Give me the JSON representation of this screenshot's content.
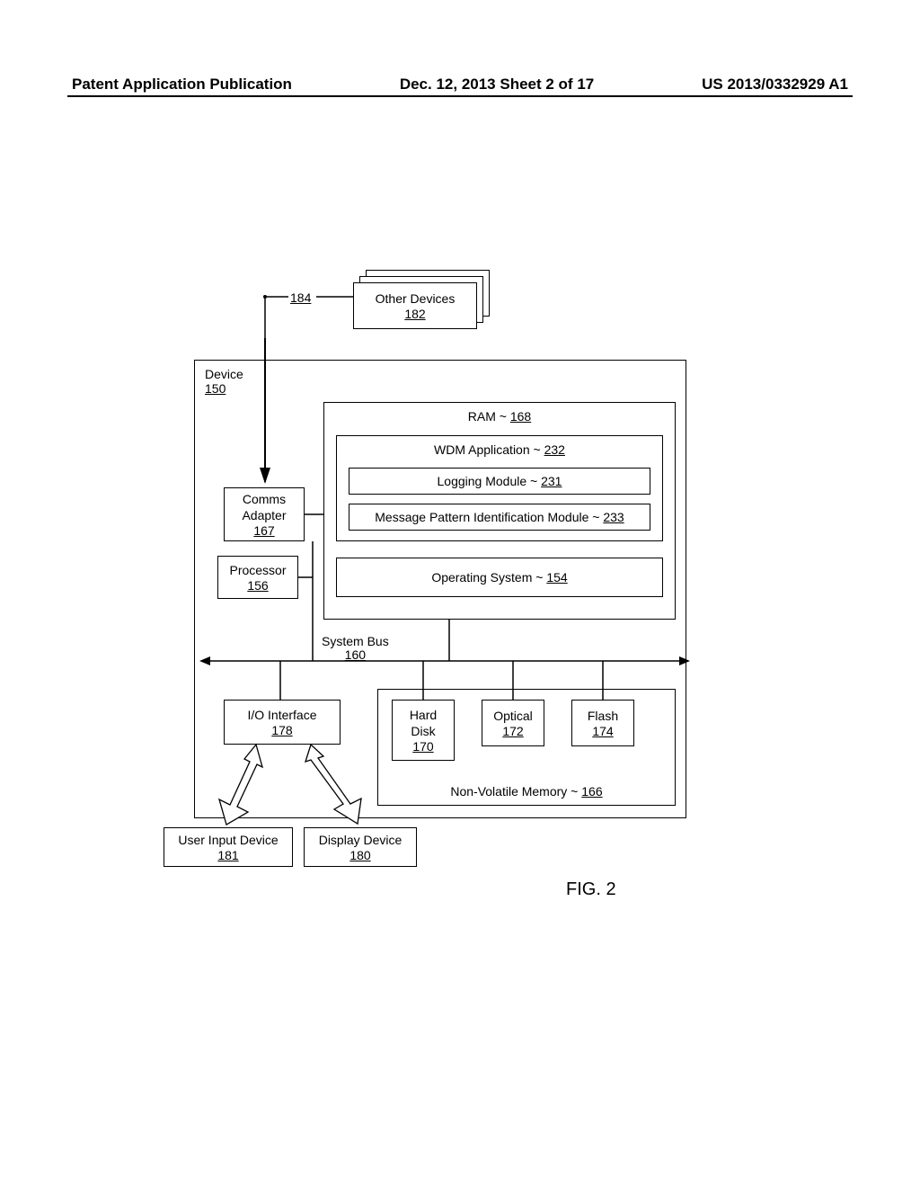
{
  "header": {
    "left": "Patent Application Publication",
    "center": "Dec. 12, 2013  Sheet 2 of 17",
    "right": "US 2013/0332929 A1"
  },
  "labels": {
    "otherDevices": "Other Devices",
    "otherDevicesRef": "182",
    "connector184": "184",
    "deviceLabel": "Device",
    "deviceRef": "150",
    "commsAdapter": "Comms\nAdapter",
    "commsAdapterRef": "167",
    "processor": "Processor",
    "processorRef": "156",
    "ram": "RAM ~",
    "ramRef": "168",
    "wdmApp": "WDM Application ~",
    "wdmAppRef": "232",
    "logging": "Logging Module ~",
    "loggingRef": "231",
    "msgPattern": "Message Pattern Identification Module ~",
    "msgPatternRef": "233",
    "os": "Operating System ~",
    "osRef": "154",
    "systemBus": "System Bus",
    "systemBusRef": "160",
    "ioInterface": "I/O Interface",
    "ioInterfaceRef": "178",
    "hardDisk": "Hard\nDisk",
    "hardDiskRef": "170",
    "optical": "Optical",
    "opticalRef": "172",
    "flash": "Flash",
    "flashRef": "174",
    "nvMem": "Non-Volatile Memory ~",
    "nvMemRef": "166",
    "userInput": "User Input Device",
    "userInputRef": "181",
    "display": "Display Device",
    "displayRef": "180",
    "figure": "FIG. 2"
  }
}
